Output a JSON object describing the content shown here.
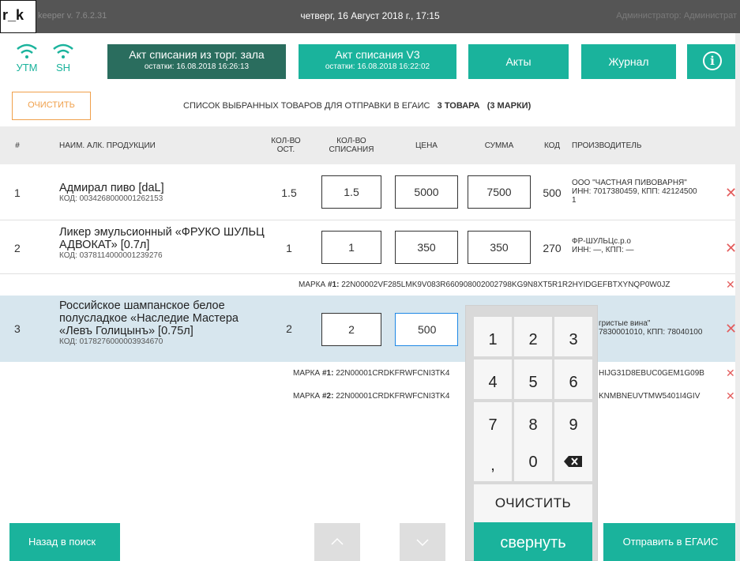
{
  "titlebar": {
    "logo": "r_k",
    "version": "keeper v. 7.6.2.31",
    "datetime": "четверг, 16 Август 2018 г., 17:15",
    "user": "Администратор: Администрат"
  },
  "status": {
    "utm_label": "УТМ",
    "sh_label": "SH"
  },
  "nav": {
    "act_hall_title": "Акт списания из торг. зала",
    "act_hall_sub": "остатки: 16.08.2018 16:26:13",
    "act_v3_title": "Акт списания V3",
    "act_v3_sub": "остатки: 16.08.2018 16:22:02",
    "acts": "Акты",
    "journal": "Журнал",
    "info_icon": "info-icon"
  },
  "toolbar": {
    "clear_label": "ОЧИСТИТЬ",
    "caption": "СПИСОК ВЫБРАННЫХ ТОВАРОВ ДЛЯ ОТПРАВКИ В ЕГАИС",
    "count": "3 ТОВАРА",
    "marks": "(3 МАРКИ)"
  },
  "table": {
    "columns": {
      "num": "#",
      "name": "НАИМ. АЛК. ПРОДУКЦИИ",
      "qty_ost": "КОЛ-ВО ОСТ.",
      "qty_write": "КОЛ-ВО СПИСАНИЯ",
      "price": "ЦЕНА",
      "sum": "СУММА",
      "kod": "КОД",
      "maker": "ПРОИЗВОДИТЕЛЬ"
    },
    "rows": [
      {
        "num": "1",
        "name": "Адмирал пиво [daL]",
        "code": "КОД: 0034268000001262153",
        "qty_ost": "1.5",
        "qty_write": "1.5",
        "price": "5000",
        "sum": "7500",
        "kod": "500",
        "maker_line1": "ООО \"ЧАСТНАЯ ПИВОВАРНЯ\"",
        "maker_line2": "ИНН: 7017380459, КПП: 42124500",
        "maker_line3": "1"
      },
      {
        "num": "2",
        "name": "Ликер эмульсионный «ФРУКО ШУЛЬЦ АДВОКАТ» [0.7л]",
        "code": "КОД: 0378114000001239276",
        "qty_ost": "1",
        "qty_write": "1",
        "price": "350",
        "sum": "350",
        "kod": "270",
        "maker_line1": "ФР-ШУЛЬЦс.р.о",
        "maker_line2": "ИНН: —, КПП: —",
        "mark_label": "МАРКА",
        "mark_num": "#1:",
        "mark_value": "22N00002VF285LMK9V083R660908002002798KG9N8XT5R1R2HYIDGEFBTXYNQP0W0JZ"
      },
      {
        "num": "3",
        "name": "Российское шампанское белое полусладкое «Наследие Мастера «Левъ Голицынъ» [0.75л]",
        "code": "КОД: 0178276000003934670",
        "qty_ost": "2",
        "qty_write": "2",
        "price": "500",
        "maker_line1": "гристые вина\"",
        "maker_line2": "7830001010, КПП: 78040100",
        "mark1_label": "МАРКА",
        "mark1_num": "#1:",
        "mark1_value": "22N00001CRDKFRWFCNI3TK4",
        "mark1_tail": "HIJG31D8EBUC0GEM1G09B",
        "mark2_label": "МАРКА",
        "mark2_num": "#2:",
        "mark2_value": "22N00001CRDKFRWFCNI3TK4",
        "mark2_tail": "KNMBNEUVTMW5401I4GIV"
      }
    ]
  },
  "numpad": {
    "keys": [
      "1",
      "2",
      "3",
      "4",
      "5",
      "6",
      "7",
      "8",
      "9",
      ",",
      "0"
    ],
    "backspace_icon": "backspace-icon",
    "clear": "ОЧИСТИТЬ",
    "collapse": "свернуть"
  },
  "bottom": {
    "back": "Назад в поиск",
    "up_icon": "chevron-up-icon",
    "down_icon": "chevron-down-icon",
    "send": "Отправить в ЕГАИС"
  },
  "colors": {
    "accent": "#1ab39c",
    "nav_dark": "#2a6d5e",
    "clear_orange": "#f0a04b",
    "delete_red": "#e35c5c",
    "selected_row": "#d7e6ee"
  }
}
